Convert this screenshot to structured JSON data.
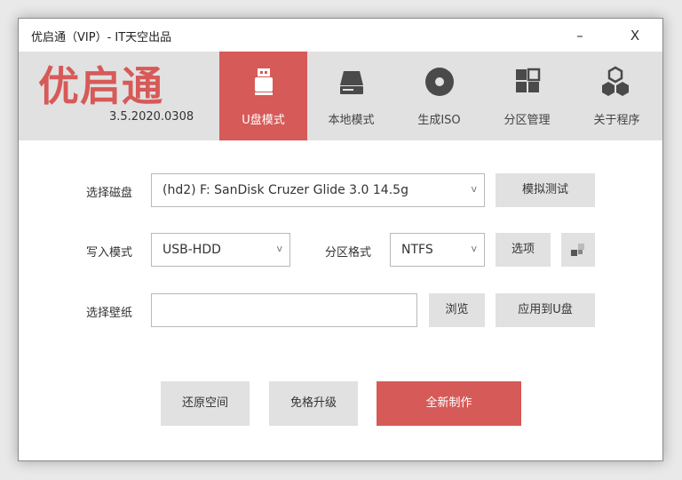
{
  "window": {
    "title": "优启通（VIP）- IT天空出品",
    "minimize_label": "–",
    "close_label": "X"
  },
  "brand": {
    "logo_text": "优启通",
    "version": "3.5.2020.0308",
    "accent_color": "#d65a58"
  },
  "tabs": [
    {
      "label": "U盘模式",
      "icon": "usb-drive-icon",
      "active": true
    },
    {
      "label": "本地模式",
      "icon": "hard-disk-icon",
      "active": false
    },
    {
      "label": "生成ISO",
      "icon": "disc-icon",
      "active": false
    },
    {
      "label": "分区管理",
      "icon": "partition-grid-icon",
      "active": false
    },
    {
      "label": "关于程序",
      "icon": "about-cubes-icon",
      "active": false
    }
  ],
  "form": {
    "disk_label": "选择磁盘",
    "disk_value": "(hd2) F: SanDisk Cruzer Glide 3.0 14.5g",
    "simulate_test_button": "模拟测试",
    "write_mode_label": "写入模式",
    "write_mode_value": "USB-HDD",
    "partition_format_label": "分区格式",
    "partition_format_value": "NTFS",
    "options_button": "选项",
    "wallpaper_label": "选择壁纸",
    "wallpaper_value": "",
    "browse_button": "浏览",
    "apply_to_u_button": "应用到U盘",
    "dropdown_arrow": "v"
  },
  "actions": {
    "restore_space": "还原空间",
    "upgrade_without_format": "免格升级",
    "create_new": "全新制作"
  }
}
